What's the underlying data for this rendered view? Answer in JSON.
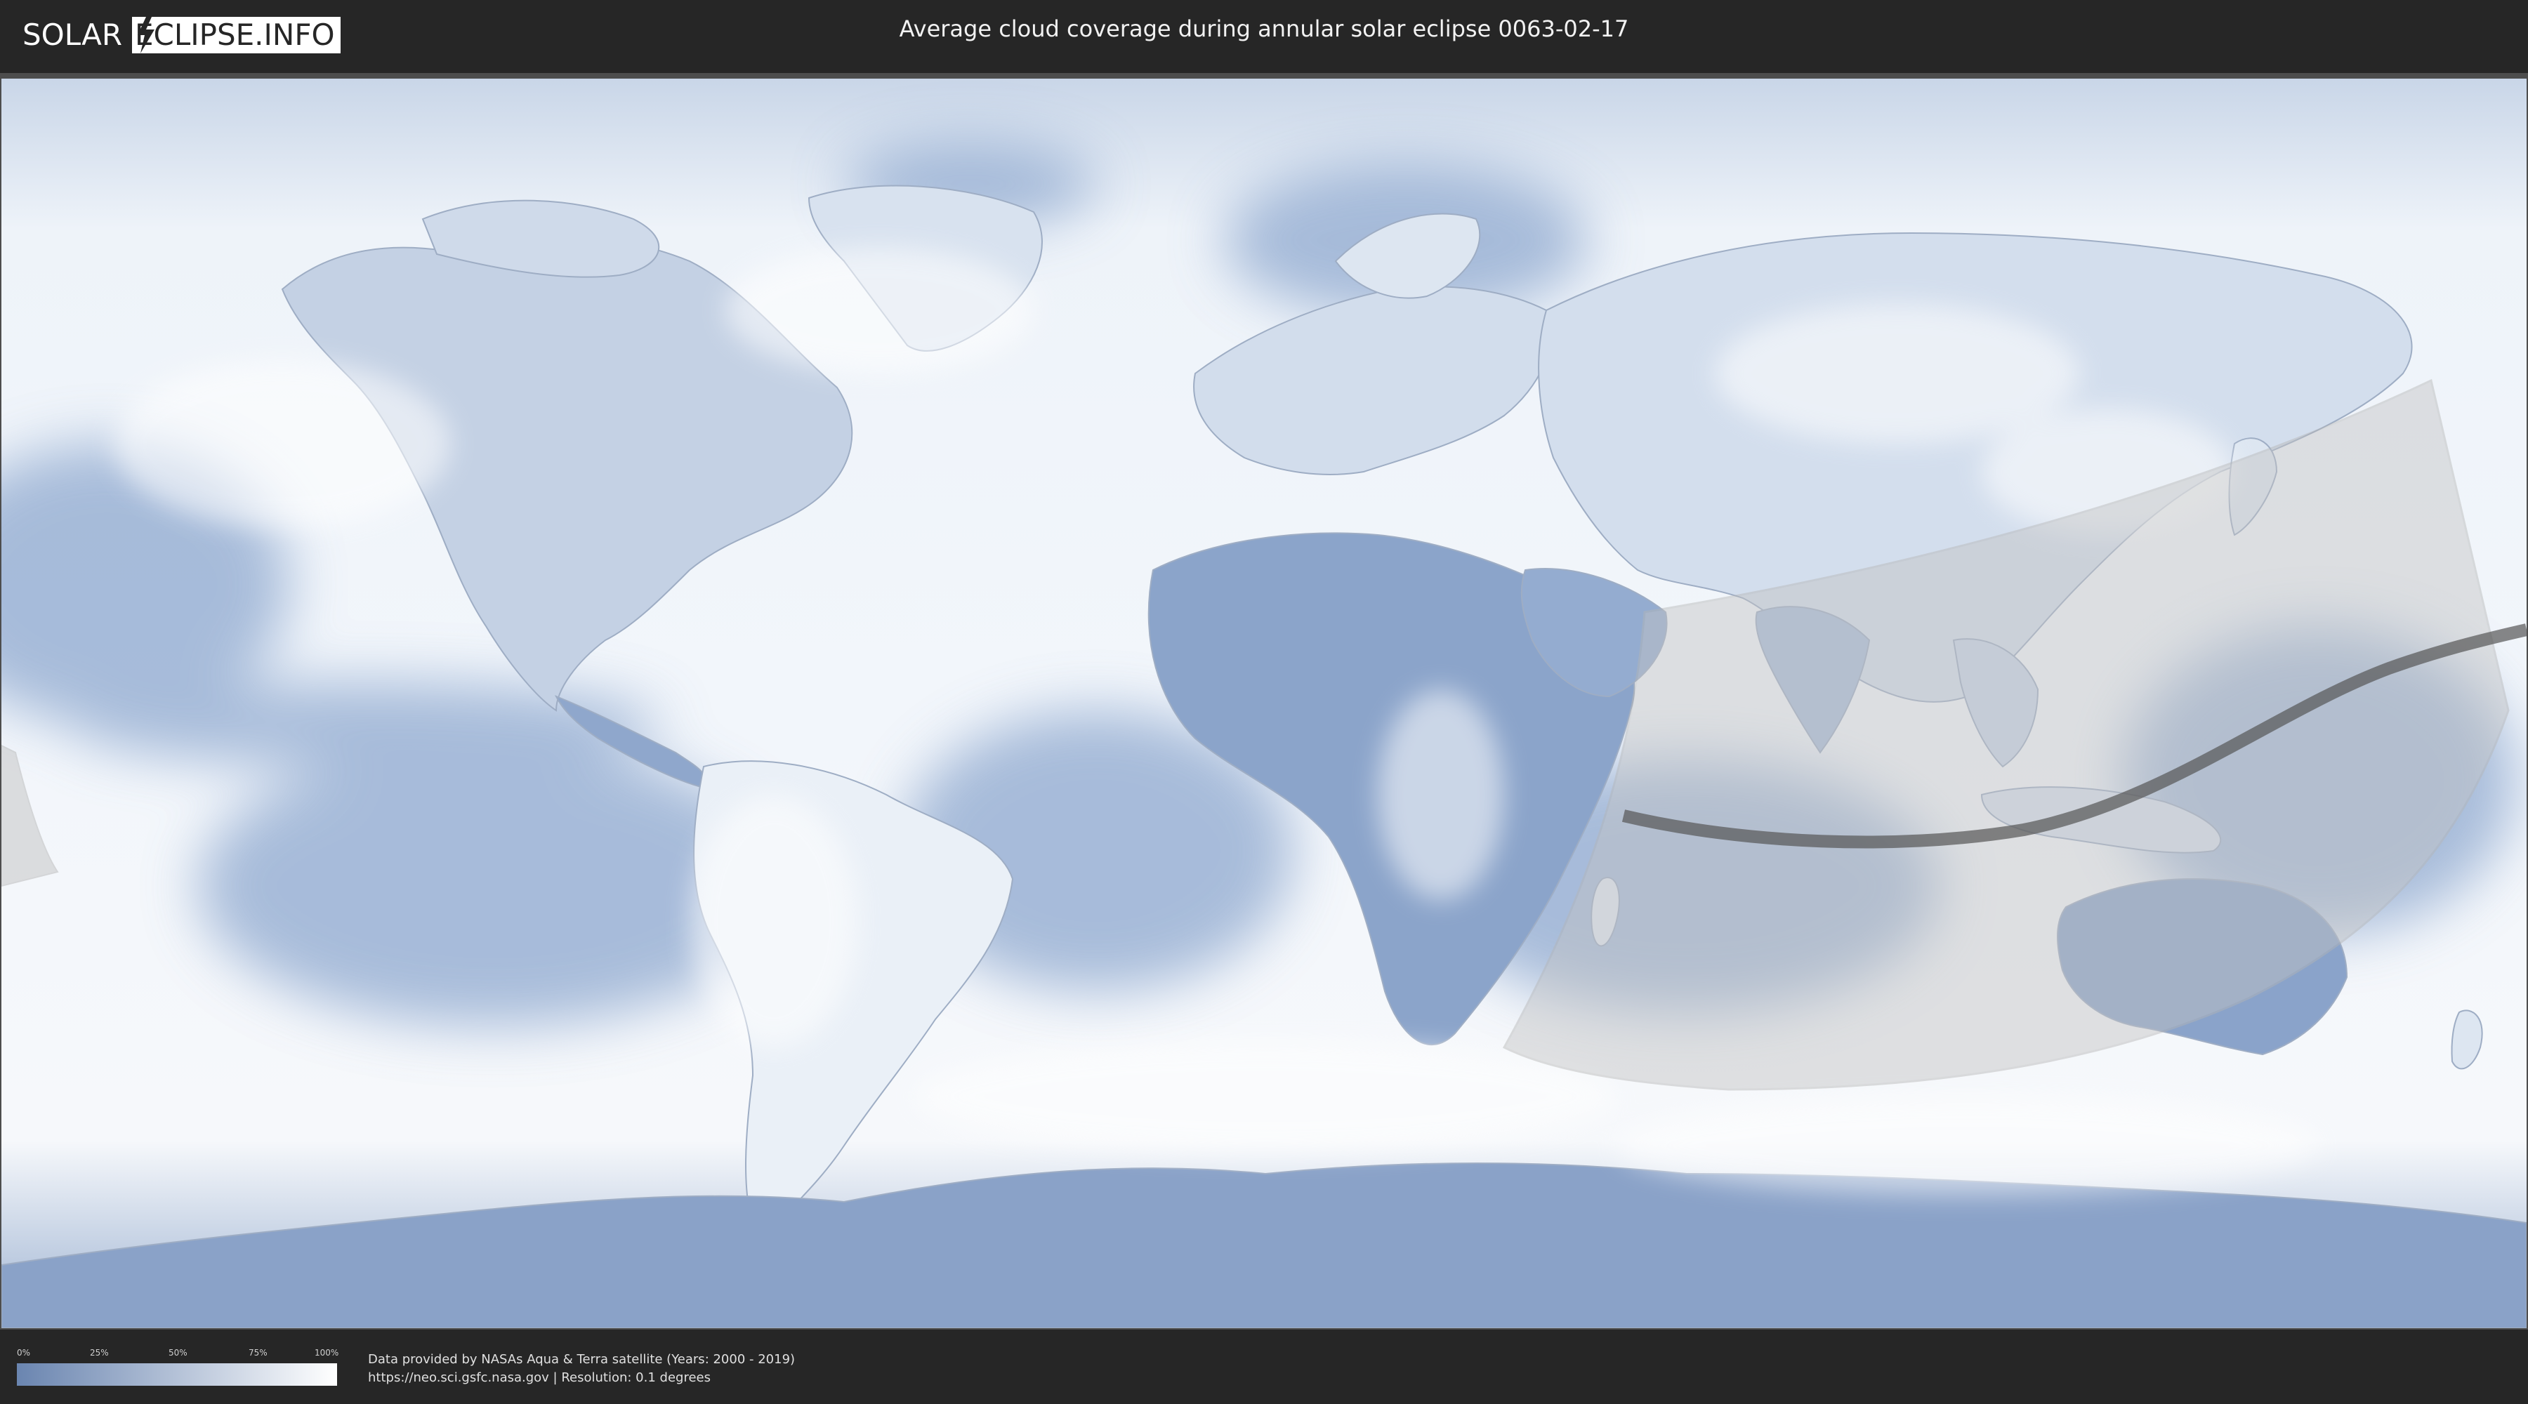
{
  "header": {
    "logo_left": "SOLAR",
    "logo_right": "ECLIPSE.INFO",
    "title": "Average cloud coverage during annular solar eclipse 0063-02-17"
  },
  "legend": {
    "ticks": [
      "0%",
      "25%",
      "50%",
      "75%",
      "100%"
    ],
    "color_low": "#6a85b0",
    "color_high": "#ffffff"
  },
  "footer": {
    "credit_line_1": "Data provided by NASAs Aqua & Terra satellite (Years: 2000 - 2019)",
    "credit_line_2": "https://neo.sci.gsfc.nasa.gov | Resolution: 0.1 degrees"
  },
  "colors": {
    "background": "#262626",
    "ocean_cloudy": "#f4f7fb",
    "clear_sky": "#7f9cc6",
    "land_outline": "#a9b4c4",
    "eclipse_zone": "#c8c8c8",
    "central_path": "#555555"
  },
  "map": {
    "projection": "equirectangular",
    "eclipse_type": "annular"
  }
}
